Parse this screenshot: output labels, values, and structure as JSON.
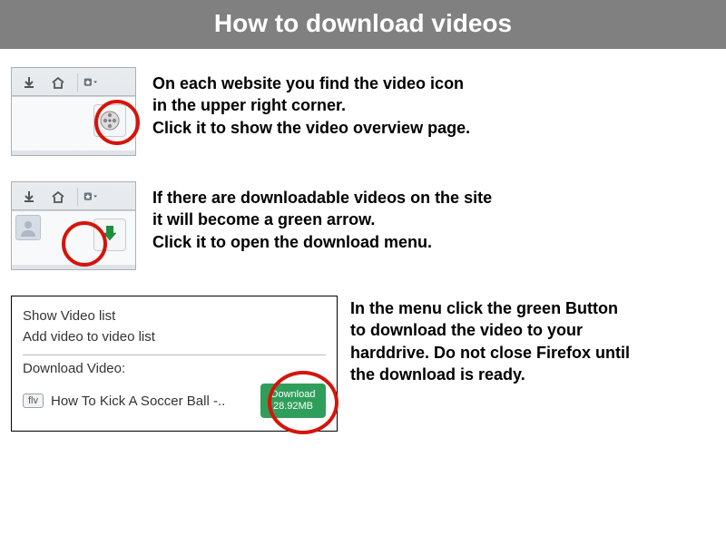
{
  "header": {
    "title": "How to download videos"
  },
  "step1": {
    "text": "On each website you find the video icon\nin the upper right corner.\nClick it to show the video overview page."
  },
  "step2": {
    "text": "If there are downloadable videos on the site\nit will become a green arrow.\nClick it to open the download menu."
  },
  "step3": {
    "menu": {
      "show_list": "Show Video list",
      "add_video": "Add video to video list",
      "download_label": "Download Video:",
      "badge": "flv",
      "video_name": "How To Kick A Soccer Ball -..",
      "button_line1": "Download",
      "button_line2": "28.92MB"
    },
    "text": "In the menu click the green Button\nto download the video to your\nharddrive. Do not close Firefox until\nthe download is ready."
  }
}
